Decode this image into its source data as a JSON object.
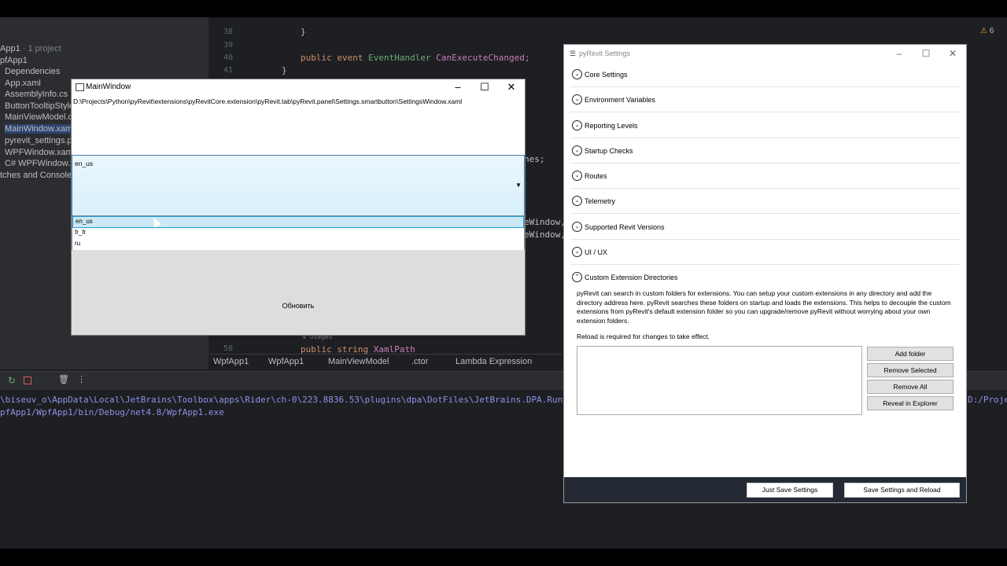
{
  "ide": {
    "project_tree": {
      "items": [
        {
          "label": "App1",
          "note": " · 1 project"
        },
        {
          "label": "pfApp1"
        },
        {
          "label": "Dependencies"
        },
        {
          "label": "App.xaml"
        },
        {
          "label": "AssemblyInfo.cs"
        },
        {
          "label": "ButtonTooltipStyle"
        },
        {
          "label": "MainViewModel.cs"
        },
        {
          "label": "MainWindow.xaml"
        },
        {
          "label": "pyrevit_settings.pn"
        },
        {
          "label": "WPFWindow.xaml"
        },
        {
          "label": "C# WPFWindow.xa"
        },
        {
          "label": "tches and Consoles"
        }
      ]
    },
    "gutter": [
      "38",
      "39",
      "40",
      "41",
      "58"
    ],
    "code": {
      "line38": "}",
      "line40_kw1": "public",
      "line40_kw2": "event",
      "line40_type": "EventHandler",
      "line40_name": "CanExecuteChanged;",
      "line41": "}",
      "frag1": "nes;",
      "frag2": "eWindow,",
      "frag3": "eWindow,",
      "usages": "4 usages",
      "line58_kw1": "public",
      "line58_kw2": "string",
      "line58_name": "XamlPath"
    },
    "breadcrumbs": [
      "WpfApp1",
      "WpfApp1",
      "MainViewModel",
      ".ctor",
      "Lambda Expression"
    ],
    "warnings": "6",
    "console": {
      "line1": "\\biseuv_o\\AppData\\Local\\JetBrains\\Toolbox\\apps\\Rider\\ch-0\\223.8836.53\\plugins\\dpa\\DotFiles\\JetBrains.DPA.Runner.exe --hand",
      "line1_right": "D:/Projec",
      "line2": "pfApp1/WpfApp1/bin/Debug/net4.8/WpfApp1.exe"
    }
  },
  "main_window": {
    "title": "MainWindow",
    "path": "D:\\Projects\\Python\\pyRevit\\extensions\\pyRevitCore.extension\\pyRevit.tab\\pyRevit.panel\\Settings.smartbutton\\SettingsWindow.xaml",
    "combo_value": "en_us",
    "options": [
      "en_us",
      "fr_fr",
      "ru"
    ],
    "selected_index": 0,
    "refresh_label": "Обновить"
  },
  "pyrevit": {
    "title": "pyRevit Settings",
    "sections": [
      {
        "label": "Core Settings",
        "expanded": false
      },
      {
        "label": "Environment Variables",
        "expanded": false
      },
      {
        "label": "Reporting Levels",
        "expanded": false
      },
      {
        "label": "Startup Checks",
        "expanded": false
      },
      {
        "label": "Routes",
        "expanded": false
      },
      {
        "label": "Telemetry",
        "expanded": false
      },
      {
        "label": "Supported Revit Versions",
        "expanded": false
      },
      {
        "label": "UI / UX",
        "expanded": false
      },
      {
        "label": "Custom Extension Directories",
        "expanded": true
      }
    ],
    "description": "pyRevit can search in custom folders for extensions. You can setup your custom extensions in any directory and add the directory address here. pyRevit searches these folders on startup and loads the extensions. This helps to decouple the custom extensions from pyRevit's default extension folder so you can upgrade/remove pyRevit without worrying about your own extension folders.",
    "reload_note": "Reload is required for changes to take effect.",
    "buttons": {
      "add_folder": "Add folder",
      "remove_selected": "Remove Selected",
      "remove_all": "Remove All",
      "reveal": "Reveal in Explorer"
    },
    "footer": {
      "just_save": "Just Save Settings",
      "save_reload": "Save Settings and Reload"
    }
  }
}
